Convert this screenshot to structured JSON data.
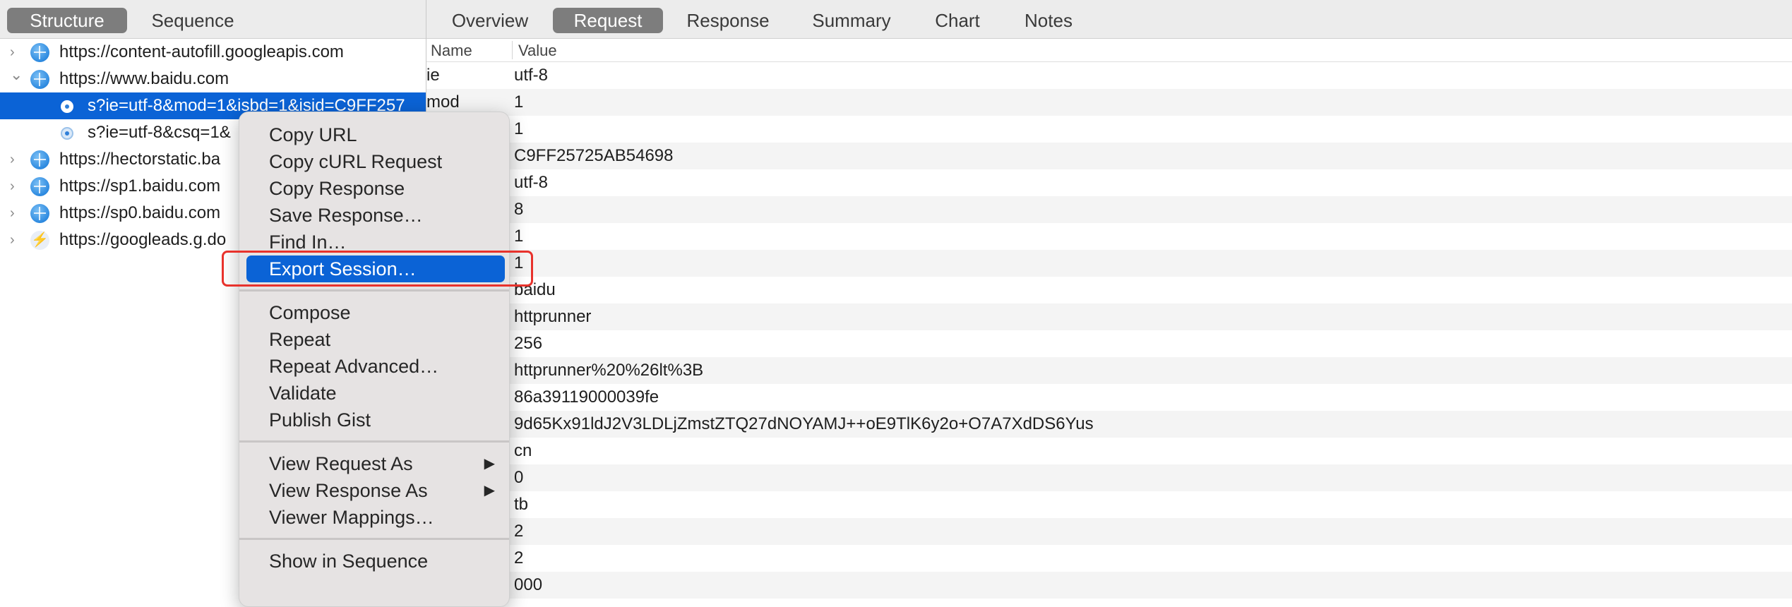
{
  "left_tabs": [
    "Structure",
    "Sequence"
  ],
  "tree": [
    {
      "label": "https://content-autofill.googleapis.com",
      "icon": "globe-icon",
      "chevron": "›"
    },
    {
      "label": "https://www.baidu.com",
      "icon": "globe-icon",
      "chevron": "⌄"
    },
    {
      "label": "s?ie=utf-8&mod=1&isbd=1&isid=C9FF257",
      "icon": "request-icon"
    },
    {
      "label": "s?ie=utf-8&csq=1&",
      "icon": "request-icon"
    },
    {
      "label": "https://hectorstatic.ba",
      "icon": "globe-icon",
      "chevron": "›"
    },
    {
      "label": "https://sp1.baidu.com",
      "icon": "globe-icon",
      "chevron": "›"
    },
    {
      "label": "https://sp0.baidu.com",
      "icon": "globe-icon",
      "chevron": "›"
    },
    {
      "label": "https://googleads.g.do",
      "icon": "bolt-icon",
      "chevron": "›"
    }
  ],
  "right_tabs": [
    "Overview",
    "Request",
    "Response",
    "Summary",
    "Chart",
    "Notes"
  ],
  "columns": {
    "name": "Name",
    "value": "Value"
  },
  "params": [
    {
      "name": "ie",
      "value": "utf-8"
    },
    {
      "name": "mod",
      "value": "1"
    },
    {
      "name": "",
      "value": "1"
    },
    {
      "name": "",
      "value": "C9FF25725AB54698"
    },
    {
      "name": "",
      "value": "utf-8"
    },
    {
      "name": "",
      "value": "8"
    },
    {
      "name": "",
      "value": "1"
    },
    {
      "name": "",
      "value": "1"
    },
    {
      "name": "",
      "value": "baidu"
    },
    {
      "name": "",
      "value": "httprunner"
    },
    {
      "name": "",
      "value": "256"
    },
    {
      "name": "",
      "value": "httprunner%20%26lt%3B"
    },
    {
      "name": "",
      "value": "86a39119000039fe"
    },
    {
      "name": "",
      "value": "9d65Kx91ldJ2V3LDLjZmstZTQ27dNOYAMJ++oE9TlK6y2o+O7A7XdDS6Yus"
    },
    {
      "name": "",
      "value": "cn"
    },
    {
      "name": "",
      "value": "0"
    },
    {
      "name": "",
      "value": "tb"
    },
    {
      "name": "",
      "value": "2"
    },
    {
      "name": "",
      "value": "2"
    },
    {
      "name": "",
      "value": "000"
    }
  ],
  "menu": {
    "groups": [
      [
        "Copy URL",
        "Copy cURL Request",
        "Copy Response",
        "Save Response…",
        "Find In…",
        "Export Session…"
      ],
      [
        "Compose",
        "Repeat",
        "Repeat Advanced…",
        "Validate",
        "Publish Gist"
      ],
      [
        "View Request As",
        "View Response As",
        "Viewer Mappings…"
      ],
      [
        "Show in Sequence"
      ]
    ],
    "highlighted": "Export Session…",
    "submenu_arrow": "▶"
  },
  "colors": {
    "selection": "#0b63d6",
    "highlight_box": "#e8322c",
    "active_tab": "#7d7d7d"
  }
}
